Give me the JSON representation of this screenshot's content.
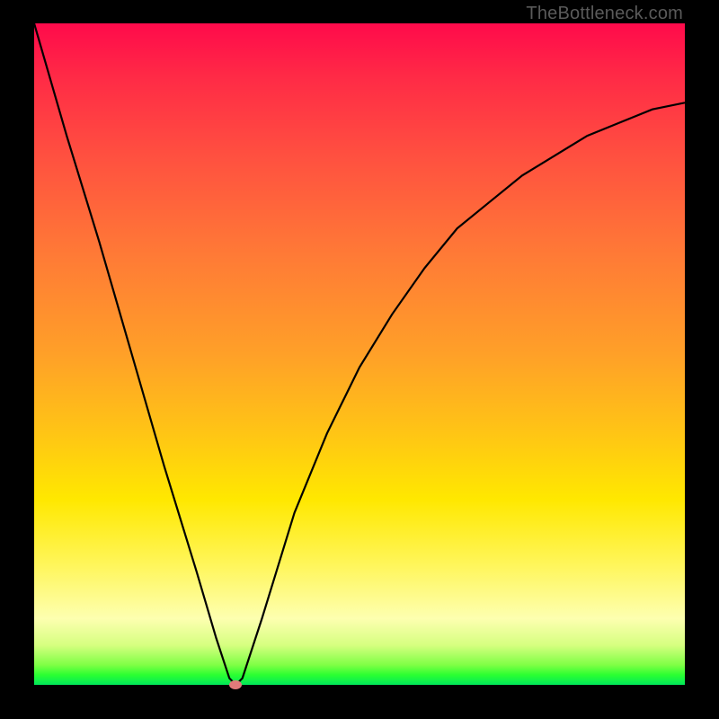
{
  "watermark": "TheBottleneck.com",
  "chart_data": {
    "type": "line",
    "title": "",
    "xlabel": "",
    "ylabel": "",
    "xlim": [
      0,
      100
    ],
    "ylim": [
      0,
      100
    ],
    "series": [
      {
        "name": "curve",
        "x": [
          0,
          5,
          10,
          15,
          20,
          25,
          28,
          30,
          31,
          32,
          35,
          40,
          45,
          50,
          55,
          60,
          65,
          70,
          75,
          80,
          85,
          90,
          95,
          100
        ],
        "y": [
          100,
          83,
          67,
          50,
          33,
          17,
          7,
          1,
          0,
          1,
          10,
          26,
          38,
          48,
          56,
          63,
          69,
          73,
          77,
          80,
          83,
          85,
          87,
          88
        ]
      }
    ],
    "marker": {
      "x": 31,
      "y": 0
    },
    "colors": {
      "curve": "#000000",
      "marker": "#e07a7a",
      "gradient_top": "#ff0a4b",
      "gradient_bottom": "#00e85a"
    }
  }
}
